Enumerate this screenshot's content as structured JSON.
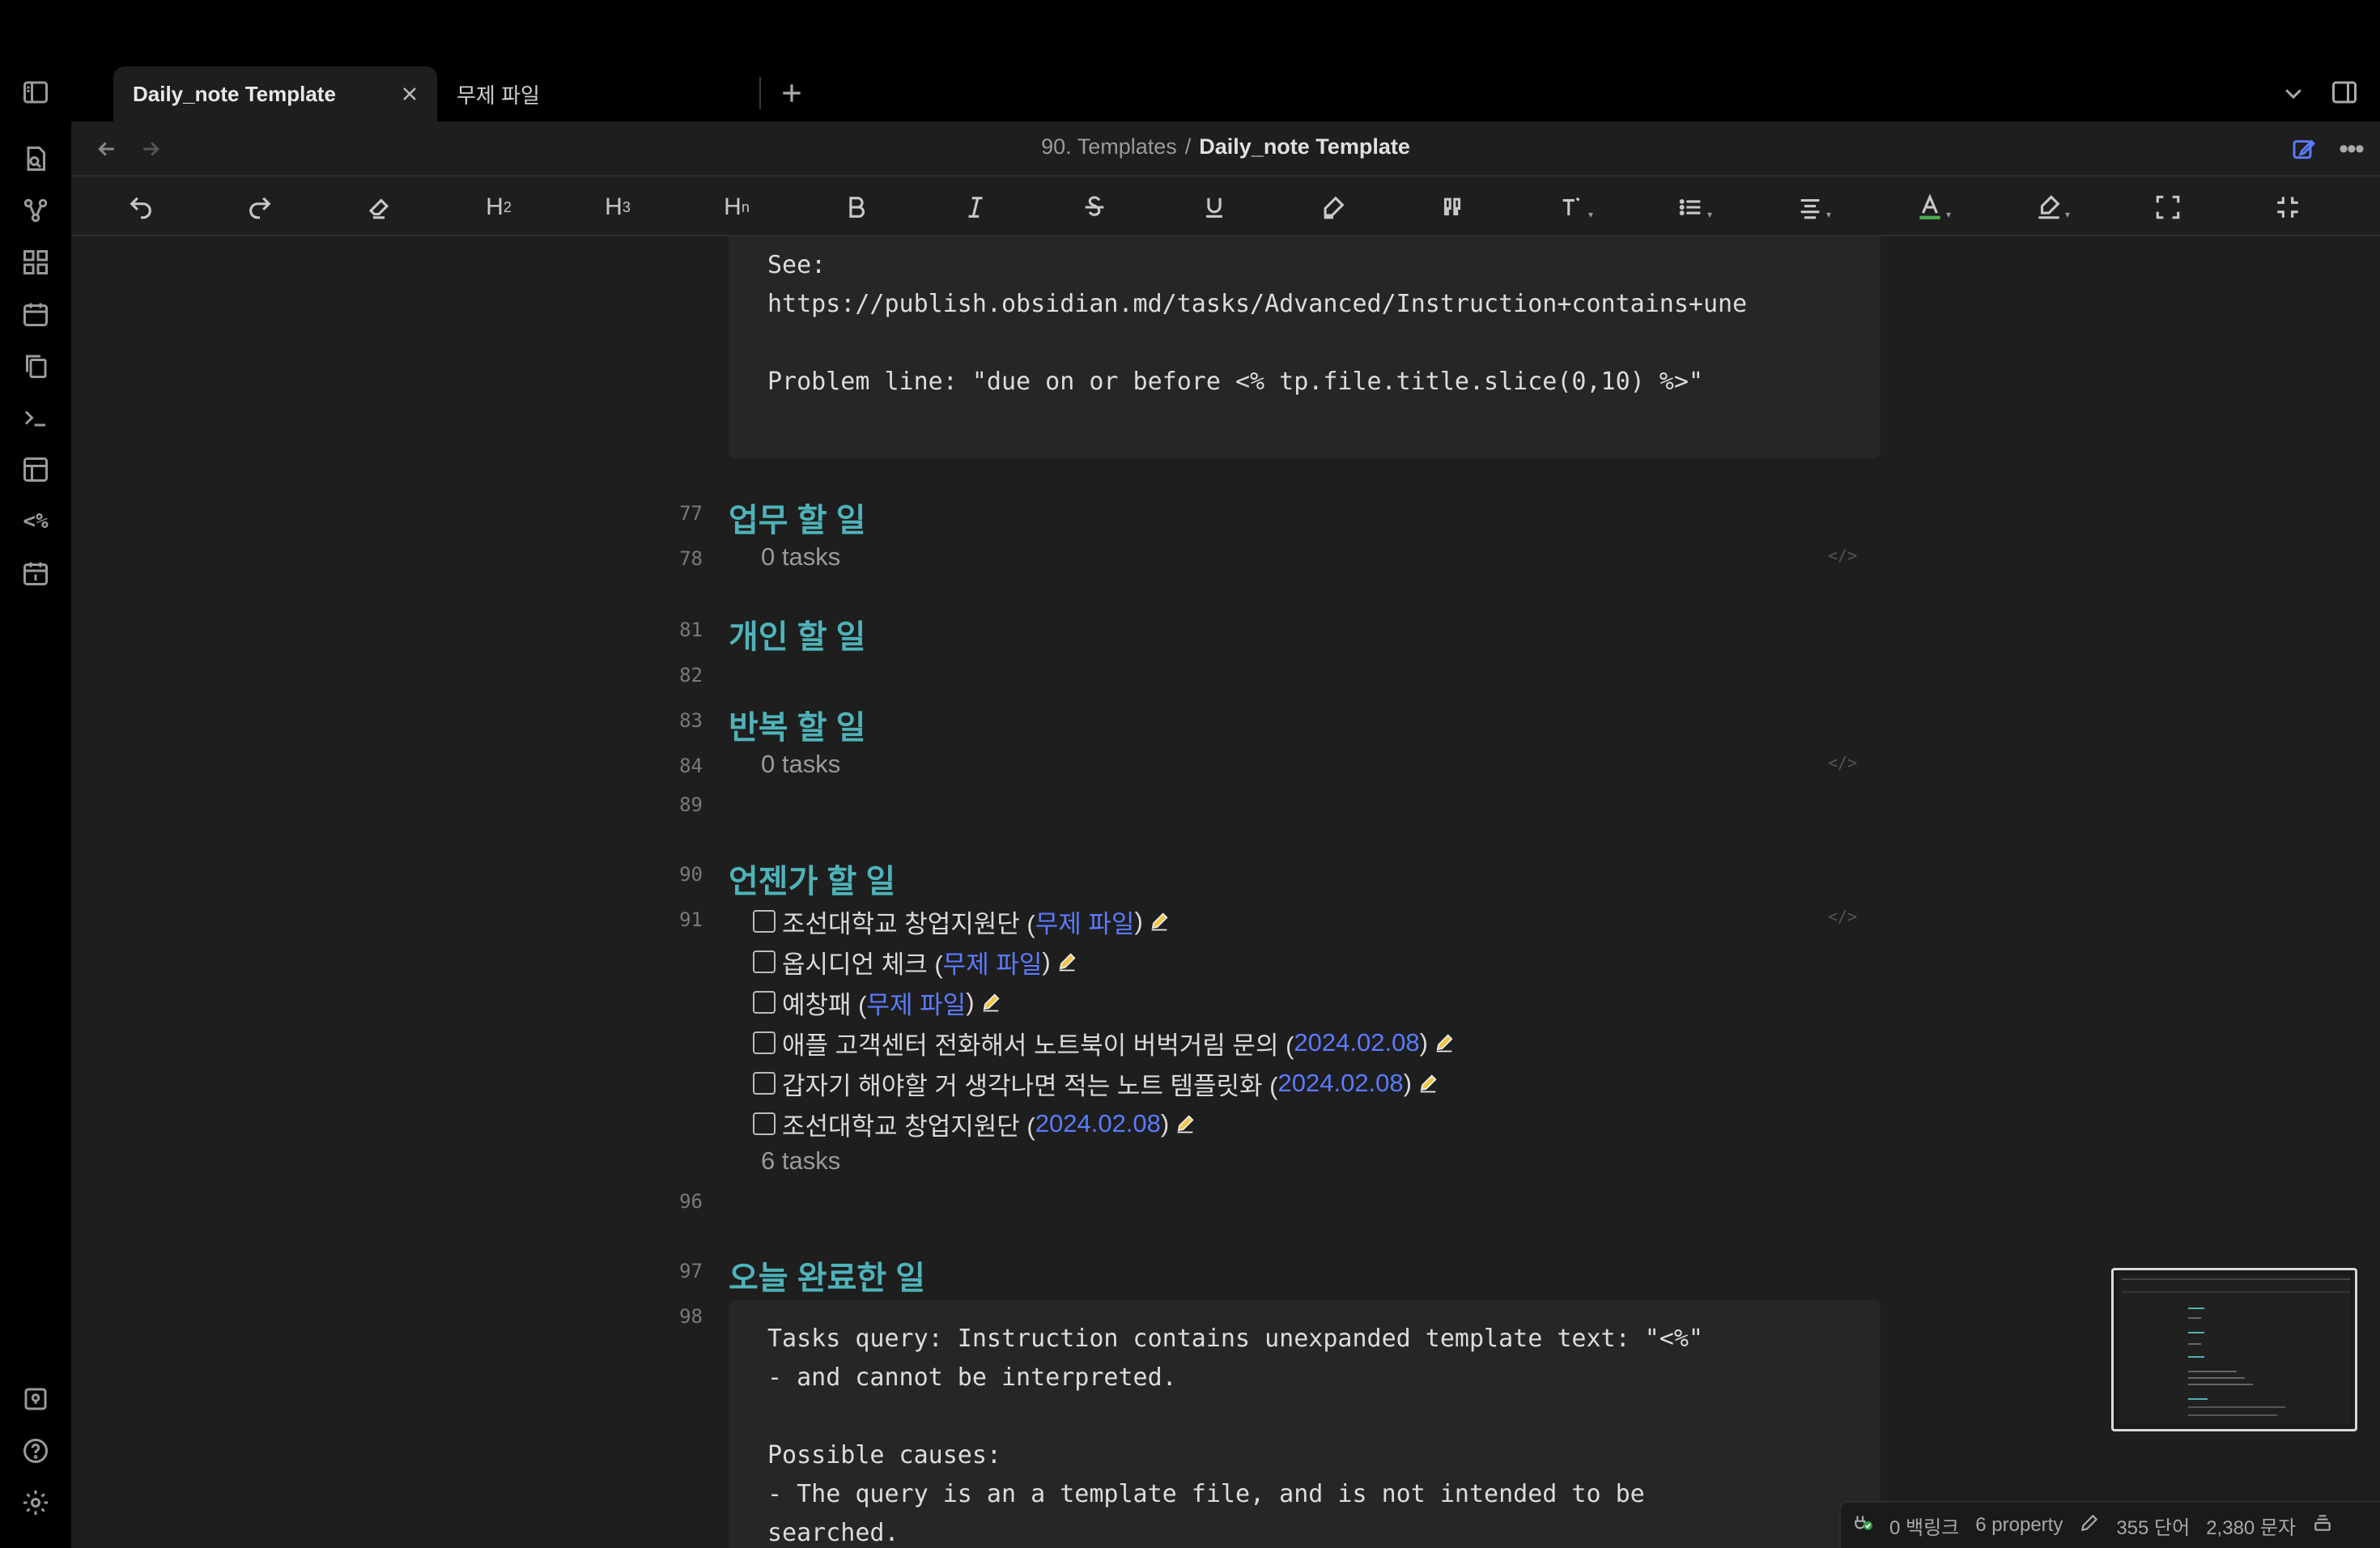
{
  "tabs": [
    {
      "label": "Daily_note Template",
      "active": true
    },
    {
      "label": "무제 파일",
      "active": false
    }
  ],
  "breadcrumb": {
    "folder": "90. Templates",
    "separator": "/",
    "current": "Daily_note Template"
  },
  "toolbar_labels": {
    "h2": "H",
    "h2_sub": "2",
    "h3": "H",
    "h3_sub": "3",
    "hn": "H",
    "hn_sub": "n"
  },
  "code_block_top": {
    "lines": [
      "See:",
      "https://publish.obsidian.md/tasks/Advanced/Instruction+contains+une",
      "",
      "Problem line: \"due on or before <% tp.file.title.slice(0,10) %>\""
    ]
  },
  "sections": {
    "work": {
      "line": "77",
      "heading": "업무 할 일",
      "count_line": "78",
      "count": "0 tasks"
    },
    "personal": {
      "line": "81",
      "heading": "개인 할 일",
      "empty_line": "82"
    },
    "recurring": {
      "line": "83",
      "heading": "반복 할 일",
      "count_line": "84",
      "count": "0 tasks",
      "empty_line": "89"
    },
    "someday": {
      "line": "90",
      "heading": "언젠가 할 일",
      "tasks_line": "91",
      "tasks": [
        {
          "text": "조선대학교 창업지원단 (",
          "link": "무제 파일",
          "close": ")"
        },
        {
          "text": "옵시디언 체크 (",
          "link": "무제 파일",
          "close": ")"
        },
        {
          "text": "예창패 (",
          "link": "무제 파일",
          "close": ")"
        },
        {
          "text": "애플 고객센터 전화해서 노트북이 버벅거림 문의 (",
          "link": "2024.02.08",
          "close": ")"
        },
        {
          "text": "갑자기 해야할 거 생각나면 적는 노트 템플릿화 (",
          "link": "2024.02.08",
          "close": ")"
        },
        {
          "text": "조선대학교 창업지원단 (",
          "link": "2024.02.08",
          "close": ")"
        }
      ],
      "count": "6 tasks",
      "empty_line": "96"
    },
    "completed": {
      "line": "97",
      "heading": "오늘 완료한 일",
      "code_line": "98"
    }
  },
  "code_block_bottom": {
    "lines": [
      "Tasks query: Instruction contains unexpanded template text: \"<%\"",
      "- and cannot be interpreted.",
      "",
      "Possible causes:",
      "- The query is an a template file, and is not intended to be",
      "searched."
    ]
  },
  "code_marker": "</>",
  "ribbon_text_icon": "<%",
  "status": {
    "backlinks": "0 백링크",
    "properties": "6 property",
    "words": "355 단어",
    "chars": "2,380 문자"
  },
  "colors": {
    "heading": "#4fb3b9",
    "link": "#5b7bff",
    "background": "#1e1e1e",
    "chrome": "#000000"
  }
}
